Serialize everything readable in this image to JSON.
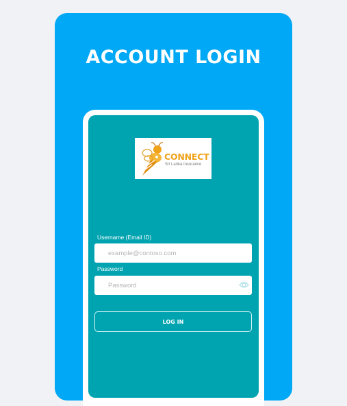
{
  "page": {
    "title": "ACCOUNT LOGIN"
  },
  "logo": {
    "brand": "CONNECT",
    "subtitle": "Sri Lanka Insurance"
  },
  "form": {
    "username_label": "Username (Email ID)",
    "username_placeholder": "example@contoso.com",
    "username_value": "",
    "password_label": "Password",
    "password_placeholder": "Password",
    "password_value": "",
    "submit_label": "LOG IN"
  },
  "icons": {
    "password_toggle": "eye-icon",
    "logo": "bee-logo-icon"
  },
  "colors": {
    "background": "#f1f2f5",
    "card": "#00a8f5",
    "panel": "#00a4b0",
    "brand": "#f0a21a"
  }
}
